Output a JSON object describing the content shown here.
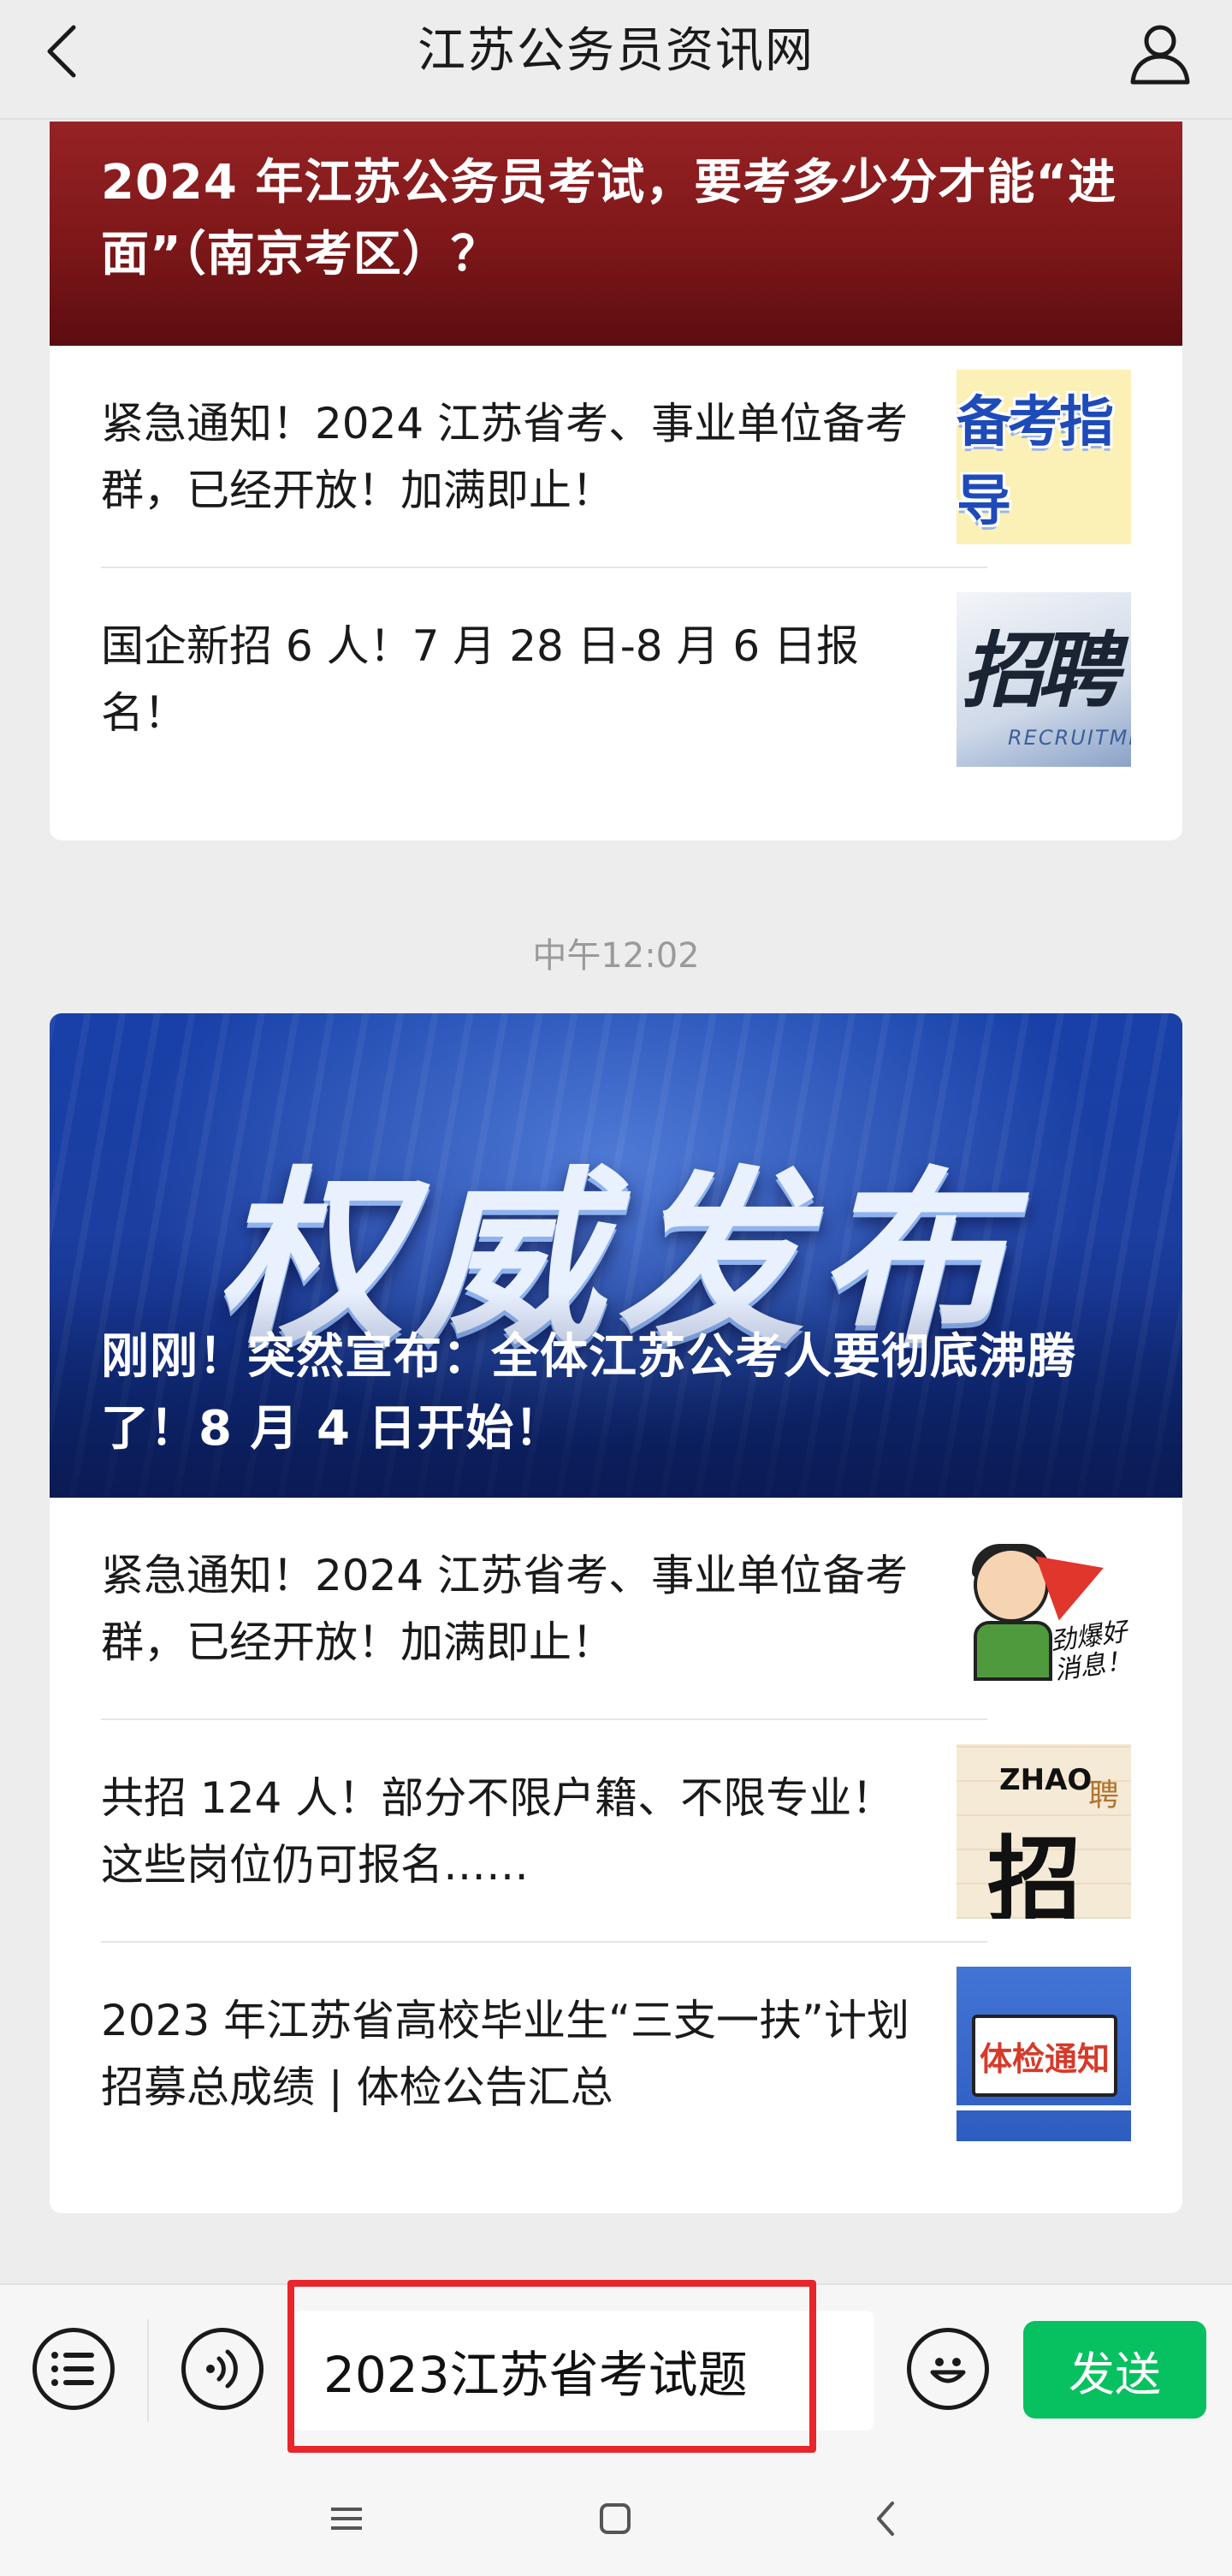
{
  "header": {
    "title": "江苏公务员资讯网"
  },
  "articles": [
    {
      "cover": {
        "title": "2024 年江苏公务员考试，要考多少分才能“进面”（南京考区）？"
      },
      "items": [
        {
          "text": "紧急通知！2024 江苏省考、事业单位备考群，已经开放！加满即止！",
          "thumb_label": "备考指导"
        },
        {
          "text": "国企新招 6 人！7 月 28 日-8 月 6 日报名！",
          "thumb_label": "招聘",
          "thumb_sub": "RECRUITMENT"
        }
      ]
    },
    {
      "cover": {
        "art_text": "权威发布",
        "title": "刚刚！突然宣布：全体江苏公考人要彻底沸腾了！8 月 4 日开始！"
      },
      "items": [
        {
          "text": "紧急通知！2024 江苏省考、事业单位备考群，已经开放！加满即止！",
          "thumb_label": "劲爆好消息！"
        },
        {
          "text": "共招 124 人！部分不限户籍、不限专业！这些岗位仍可报名……",
          "thumb_label": "招",
          "thumb_en": "ZHAO",
          "thumb_side": "聘"
        },
        {
          "text": "2023 年江苏省高校毕业生“三支一扶”计划招募总成绩 | 体检公告汇总",
          "thumb_label": "体检通知"
        }
      ]
    }
  ],
  "time_label": "中午12:02",
  "input_bar": {
    "value": "2023江苏省考试题",
    "send_label": "发送"
  }
}
